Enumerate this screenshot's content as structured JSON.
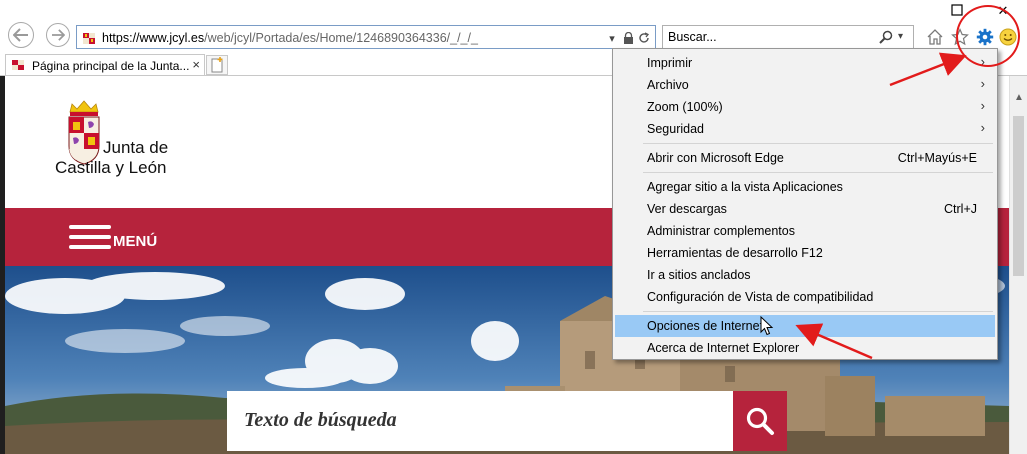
{
  "browser": {
    "address": {
      "host": "https://www.jcyl.es",
      "path": "/web/jcyl/Portada/es/Home/1246890364336/_/_/_"
    },
    "search_placeholder": "Buscar...",
    "tab": {
      "title": "Página principal de la Junta..."
    },
    "window_controls": {
      "maximize": "☐",
      "close": "✕"
    }
  },
  "site": {
    "brand_line1": "Junta de",
    "brand_line2": "Castilla y León",
    "menu_label": "MENÚ",
    "search_placeholder": "Texto de búsqueda",
    "accent_color": "#b6233c"
  },
  "tools_menu": {
    "items": [
      {
        "label": "Imprimir",
        "submenu": true
      },
      {
        "label": "Archivo",
        "submenu": true
      },
      {
        "label": "Zoom (100%)",
        "submenu": true
      },
      {
        "label": "Seguridad",
        "submenu": true
      },
      {
        "label": "Abrir con Microsoft Edge",
        "shortcut": "Ctrl+Mayús+E"
      },
      {
        "label": "Agregar sitio a la vista Aplicaciones"
      },
      {
        "label": "Ver descargas",
        "shortcut": "Ctrl+J"
      },
      {
        "label": "Administrar complementos"
      },
      {
        "label": "Herramientas de desarrollo F12"
      },
      {
        "label": "Ir a sitios anclados"
      },
      {
        "label": "Configuración de Vista de compatibilidad"
      },
      {
        "label": "Opciones de Internet",
        "highlighted": true
      },
      {
        "label": "Acerca de Internet Explorer"
      }
    ],
    "submenu_glyph": "›",
    "highlight_color": "#99c9f5"
  }
}
